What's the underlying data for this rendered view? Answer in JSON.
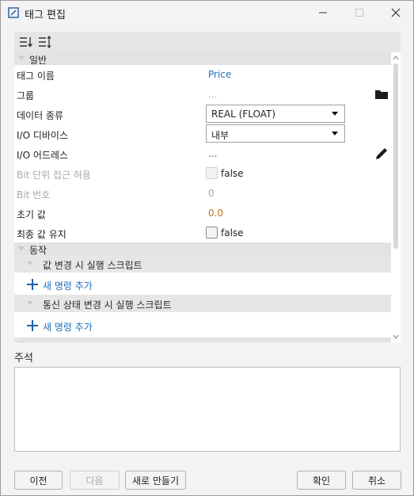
{
  "window": {
    "title": "태그 편집"
  },
  "toolbar": {
    "icons": [
      "sort-categorized-icon",
      "sort-alphabetical-icon"
    ]
  },
  "grid": {
    "category_general": "일반",
    "rows": {
      "tag_name": {
        "label": "태그 이름",
        "value": "Price"
      },
      "group": {
        "label": "그룹",
        "value": "..."
      },
      "data_type": {
        "label": "데이터 종류",
        "value": "REAL (FLOAT)"
      },
      "io_device": {
        "label": "I/O 디바이스",
        "value": "내부"
      },
      "io_address": {
        "label": "I/O 어드레스",
        "value": "..."
      },
      "bit_access": {
        "label": "Bit 단위 접근 허용",
        "value": "false"
      },
      "bit_number": {
        "label": "Bit 번호",
        "value": "0"
      },
      "initial_value": {
        "label": "초기 값",
        "value": "0.0"
      },
      "keep_last_value": {
        "label": "최종 값 유지",
        "value": "false"
      }
    },
    "category_action": "동작",
    "sub_value_change": "값 변경 시 실행 스크립트",
    "add_command_1": "새 명령 추가",
    "sub_comm_change": "통신 상태 변경 시 실행 스크립트",
    "add_command_2": "새 명령 추가"
  },
  "comment": {
    "label": "주석",
    "value": ""
  },
  "buttons": {
    "prev": "이전",
    "next": "다음",
    "new": "새로 만들기",
    "ok": "확인",
    "cancel": "취소"
  }
}
